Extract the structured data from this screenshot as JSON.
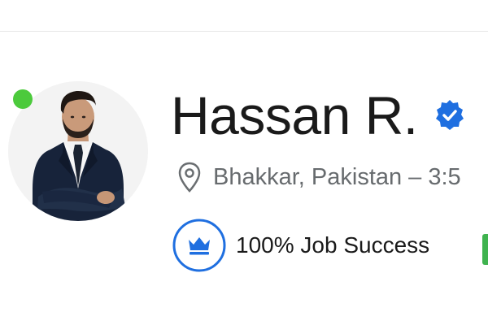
{
  "profile": {
    "name": "Hassan R.",
    "location": "Bhakkar, Pakistan – 3:5",
    "job_success": "100% Job Success",
    "status": "online",
    "verified": true
  },
  "icons": {
    "verified": "verified-badge-icon",
    "location": "map-pin-icon",
    "job_success": "crown-icon",
    "online": "online-status-dot"
  },
  "colors": {
    "online_green": "#4cca3c",
    "verified_blue": "#1f6fe0",
    "badge_blue": "#1f6fe0",
    "name_text": "#1a1a1a",
    "location_text": "#676b6e",
    "edge_green": "#3fb34f"
  }
}
